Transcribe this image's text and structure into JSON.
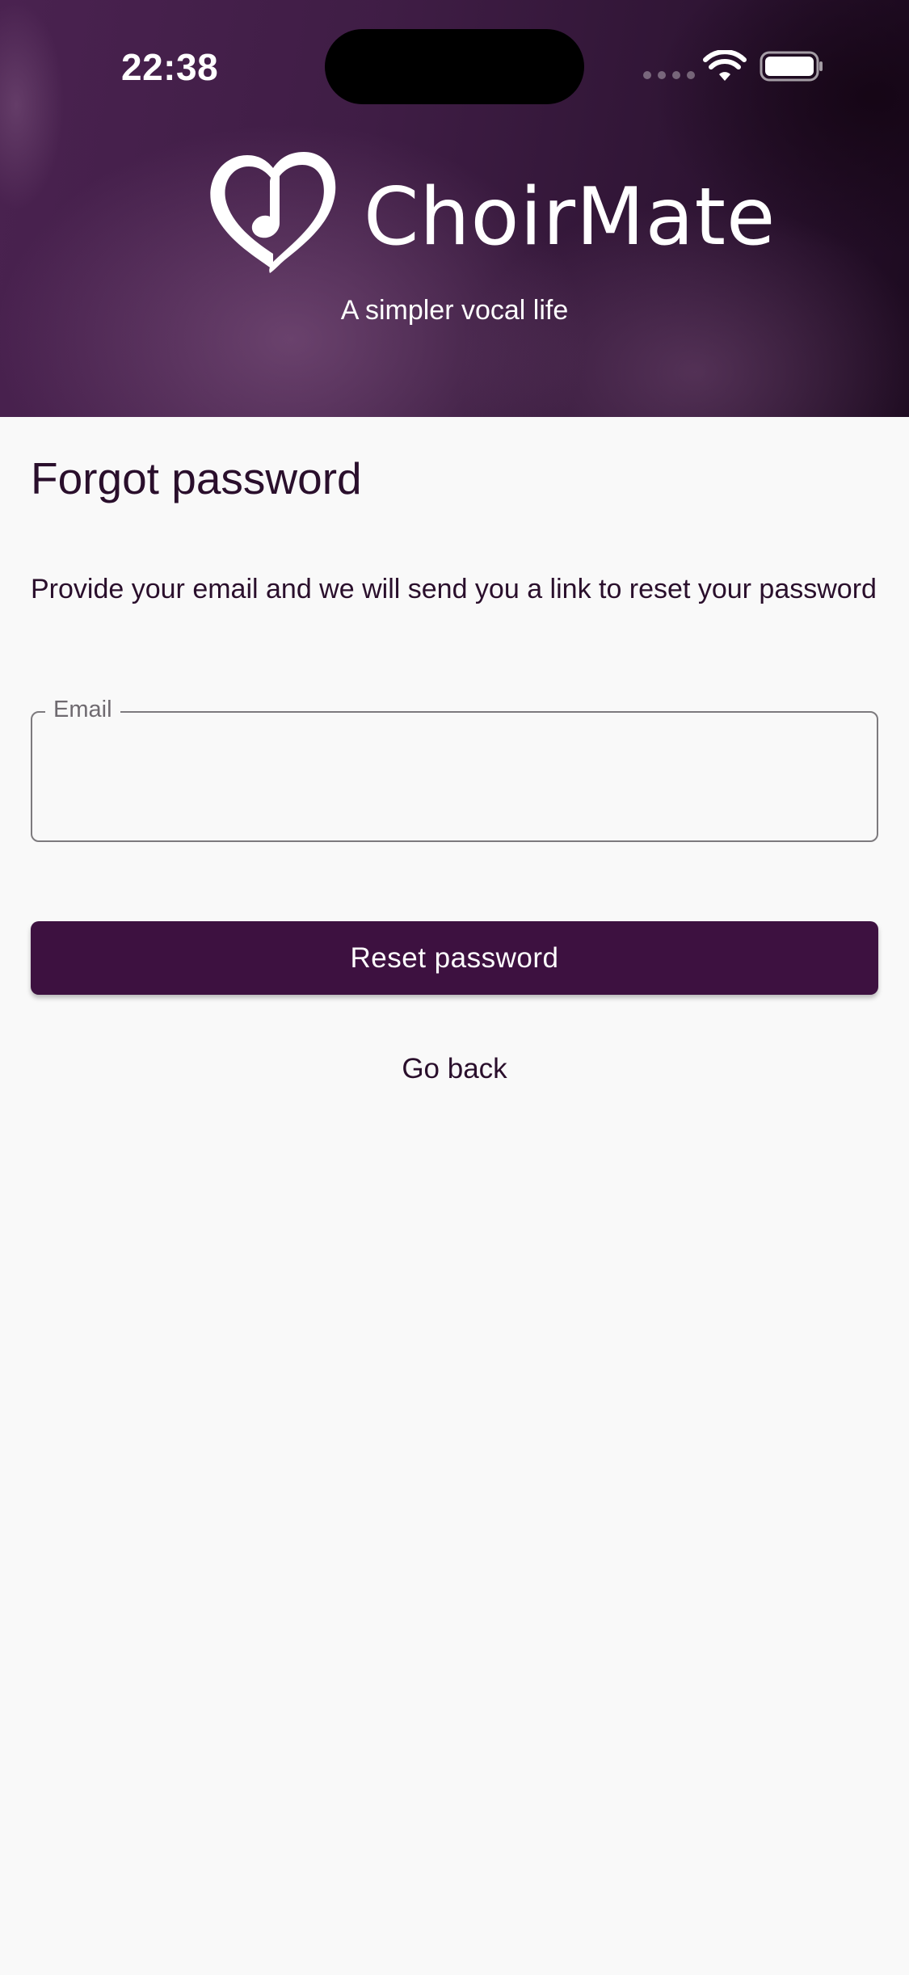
{
  "status_bar": {
    "time": "22:38",
    "icons": [
      "cellular-dots-icon",
      "wifi-icon",
      "battery-icon"
    ]
  },
  "header": {
    "logo_icon": "heart-music-note-icon",
    "brand_name": "ChoirMate",
    "tagline": "A simpler vocal life"
  },
  "main": {
    "title": "Forgot password",
    "description": "Provide your email and we will send you a link to reset your password",
    "email_field": {
      "label": "Email",
      "value": "",
      "placeholder": ""
    },
    "reset_button_label": "Reset password",
    "go_back_label": "Go back"
  },
  "colors": {
    "primary": "#3d1140",
    "text": "#2a0f2c",
    "background": "#f9f9f9",
    "header_gradient_start": "#4a2250",
    "header_gradient_end": "#1c0a1f"
  }
}
